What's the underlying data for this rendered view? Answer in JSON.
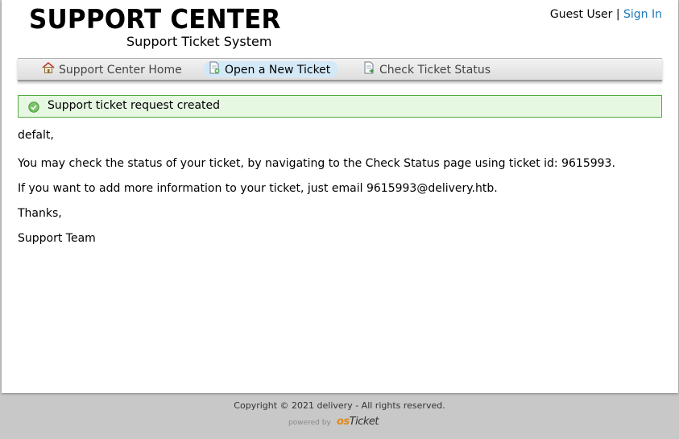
{
  "header": {
    "title": "SUPPORT CENTER",
    "subtitle": "Support Ticket System",
    "guest_label": "Guest User",
    "separator": "|",
    "sign_in": "Sign In"
  },
  "nav": {
    "items": [
      {
        "label": "Support Center Home",
        "icon": "home-icon"
      },
      {
        "label": "Open a New Ticket",
        "icon": "new-ticket-icon"
      },
      {
        "label": "Check Ticket Status",
        "icon": "ticket-status-icon"
      }
    ],
    "active_index": 1
  },
  "notice": {
    "text": "Support ticket request created",
    "icon": "check-circle-icon"
  },
  "message": {
    "greeting": "defalt,",
    "line1": "You may check the status of your ticket, by navigating to the Check Status page using ticket id: 9615993.",
    "line2": "If you want to add more information to your ticket, just email 9615993@delivery.htb.",
    "thanks": "Thanks,",
    "signature": "Support Team"
  },
  "footer": {
    "copyright": "Copyright © 2021 delivery - All rights reserved.",
    "powered_by": "powered by",
    "brand_os": "os",
    "brand_ticket": "Ticket"
  },
  "colors": {
    "link": "#1a78b8",
    "notice_bg": "#e6f8e2",
    "notice_border": "#55aa44",
    "nav_active": "#d4e9f8",
    "brand_orange": "#e08a1e"
  }
}
